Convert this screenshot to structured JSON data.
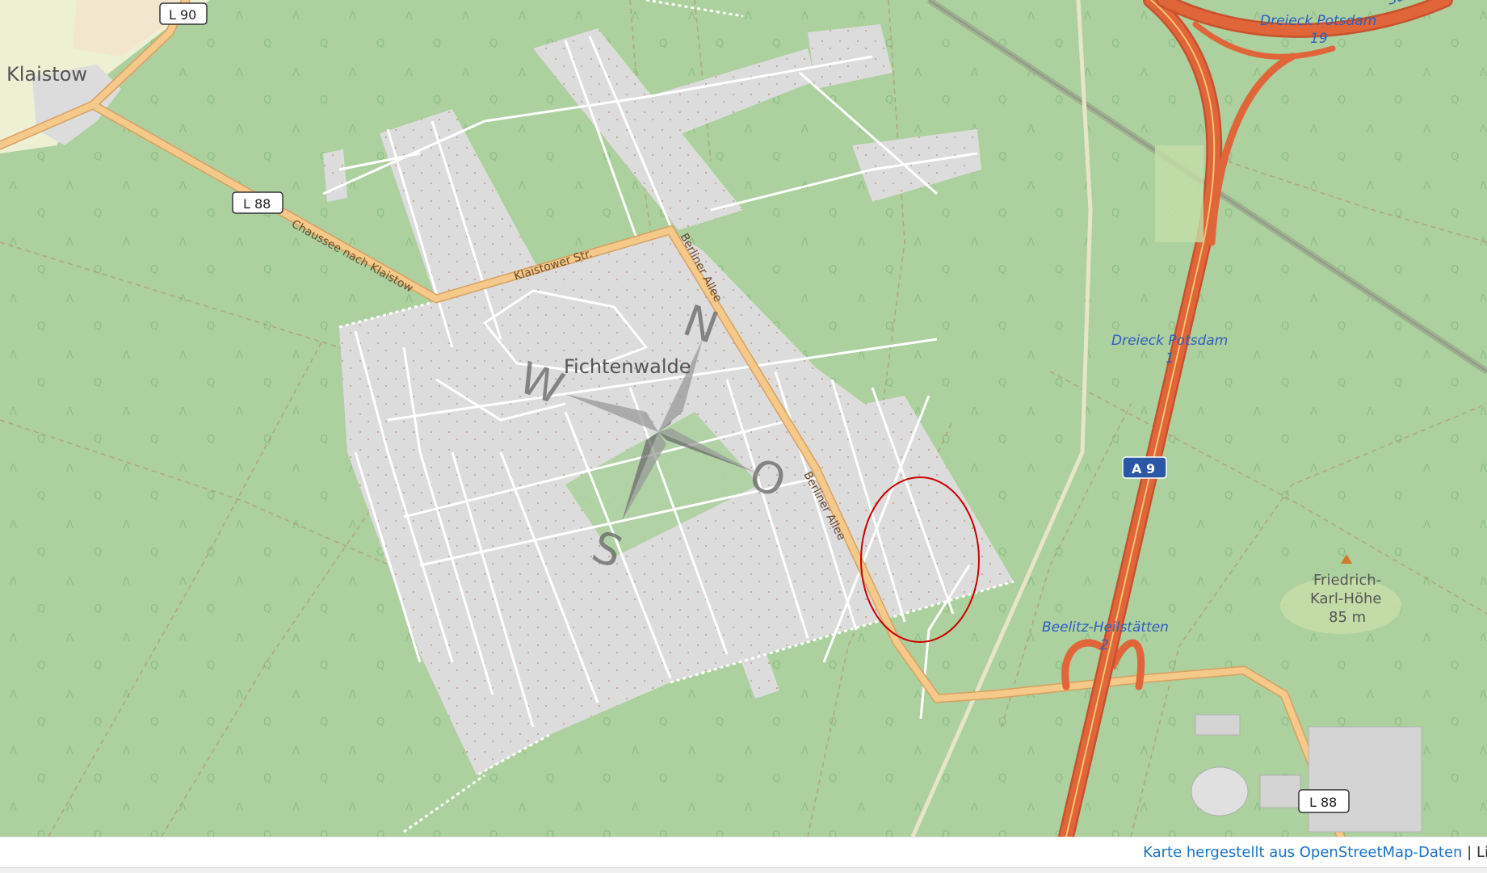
{
  "map": {
    "places": {
      "klaistow": "Klaistow",
      "fichtenwalde": "Fichtenwalde",
      "peak_name_line1": "Friedrich-",
      "peak_name_line2": "Karl-Höhe",
      "peak_elevation": "85 m"
    },
    "streets": {
      "chaussee": "Chaussee nach Klaistow",
      "klaistower": "Klaistower Str.",
      "berliner_allee_north": "Berliner Allee",
      "berliner_allee_south": "Berliner Allee"
    },
    "road_shields": {
      "l90": "L 90",
      "l88_west": "L 88",
      "l88_east": "L 88",
      "a9": "A 9"
    },
    "motorway_junctions": {
      "dreieck_19_name": "Dreieck Potsdam",
      "dreieck_19_num": "19",
      "dreieck_1_name": "Dreieck Potsdam",
      "dreieck_1_num": "1",
      "beelitz_name": "Beelitz-Heilstätten",
      "beelitz_num": "2",
      "top_right_fragment": "Sü"
    },
    "compass": {
      "n": "N",
      "w": "W",
      "s": "S",
      "o": "O"
    },
    "colors": {
      "forest": "#a9d09a",
      "residential": "#dcdcdc",
      "secondary_road": "#f5c98a",
      "motorway": "#e0663a",
      "highlight_ellipse": "#cc0000"
    }
  },
  "attribution": {
    "link_text": "Karte hergestellt aus OpenStreetMap-Daten",
    "separator": " | ",
    "license_fragment": "Li"
  }
}
